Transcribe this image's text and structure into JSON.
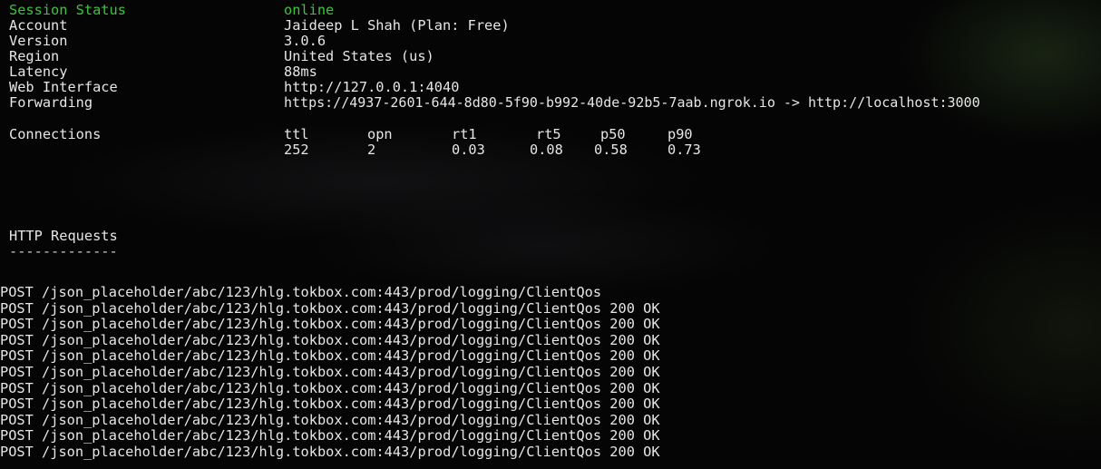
{
  "colors": {
    "status_online": "#3ec43e",
    "text": "#e6e6e6",
    "background": "#050505"
  },
  "session": {
    "rows": [
      {
        "label": "Session Status",
        "value": "online"
      },
      {
        "label": "Account",
        "value": "Jaideep L Shah (Plan: Free)"
      },
      {
        "label": "Version",
        "value": "3.0.6"
      },
      {
        "label": "Region",
        "value": "United States (us)"
      },
      {
        "label": "Latency",
        "value": "88ms"
      },
      {
        "label": "Web Interface",
        "value": "http://127.0.0.1:4040"
      },
      {
        "label": "Forwarding",
        "value": "https://4937-2601-644-8d80-5f90-b992-40de-92b5-7aab.ngrok.io -> http://localhost:3000"
      }
    ]
  },
  "connections": {
    "label": "Connections",
    "headers": [
      "ttl",
      "opn",
      "rt1",
      "rt5",
      "p50",
      "p90"
    ],
    "values": [
      "252",
      "2",
      "0.03",
      "0.08",
      "0.58",
      "0.73"
    ]
  },
  "http_requests": {
    "title": "HTTP Requests",
    "separator": "-------------",
    "requests": [
      {
        "method": "POST",
        "path": "/json_placeholder/abc/123/hlg.tokbox.com:443/prod/logging/ClientQos",
        "status": ""
      },
      {
        "method": "POST",
        "path": "/json_placeholder/abc/123/hlg.tokbox.com:443/prod/logging/ClientQos",
        "status": "200 OK"
      },
      {
        "method": "POST",
        "path": "/json_placeholder/abc/123/hlg.tokbox.com:443/prod/logging/ClientQos",
        "status": "200 OK"
      },
      {
        "method": "POST",
        "path": "/json_placeholder/abc/123/hlg.tokbox.com:443/prod/logging/ClientQos",
        "status": "200 OK"
      },
      {
        "method": "POST",
        "path": "/json_placeholder/abc/123/hlg.tokbox.com:443/prod/logging/ClientQos",
        "status": "200 OK"
      },
      {
        "method": "POST",
        "path": "/json_placeholder/abc/123/hlg.tokbox.com:443/prod/logging/ClientQos",
        "status": "200 OK"
      },
      {
        "method": "POST",
        "path": "/json_placeholder/abc/123/hlg.tokbox.com:443/prod/logging/ClientQos",
        "status": "200 OK"
      },
      {
        "method": "POST",
        "path": "/json_placeholder/abc/123/hlg.tokbox.com:443/prod/logging/ClientQos",
        "status": "200 OK"
      },
      {
        "method": "POST",
        "path": "/json_placeholder/abc/123/hlg.tokbox.com:443/prod/logging/ClientQos",
        "status": "200 OK"
      },
      {
        "method": "POST",
        "path": "/json_placeholder/abc/123/hlg.tokbox.com:443/prod/logging/ClientQos",
        "status": "200 OK"
      },
      {
        "method": "POST",
        "path": "/json_placeholder/abc/123/hlg.tokbox.com:443/prod/logging/ClientQos",
        "status": "200 OK"
      }
    ]
  }
}
